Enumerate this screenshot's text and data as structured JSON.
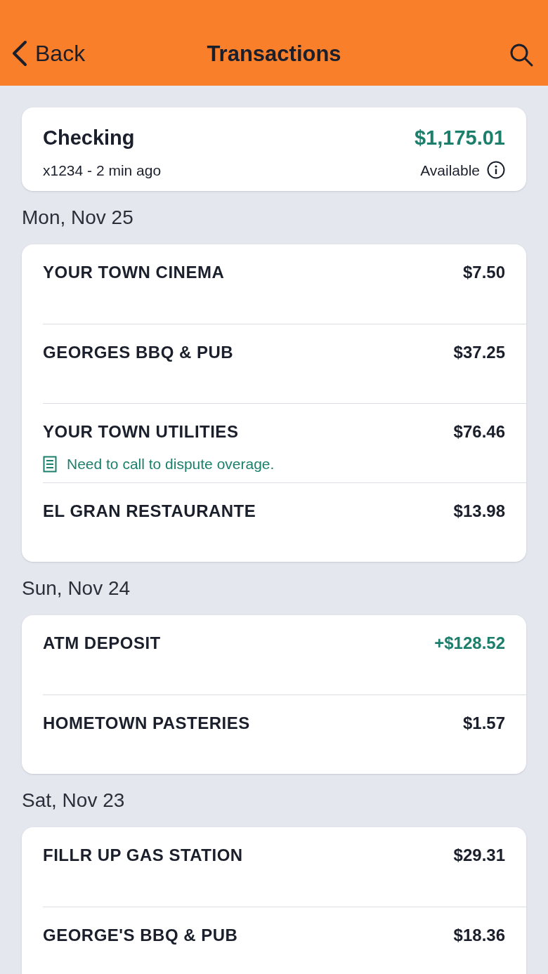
{
  "header": {
    "back": "Back",
    "title": "Transactions"
  },
  "account": {
    "name": "Checking",
    "meta": "x1234 - 2 min ago",
    "balance": "$1,175.01",
    "balance_label": "Available"
  },
  "groups": [
    {
      "date": "Mon, Nov 25",
      "transactions": [
        {
          "name": "YOUR TOWN CINEMA",
          "amount": "$7.50",
          "kind": "debit"
        },
        {
          "name": "GEORGES BBQ & PUB",
          "amount": "$37.25",
          "kind": "debit"
        },
        {
          "name": "YOUR TOWN UTILITIES",
          "amount": "$76.46",
          "kind": "debit",
          "note": "Need to call to dispute overage."
        },
        {
          "name": "EL GRAN RESTAURANTE",
          "amount": "$13.98",
          "kind": "debit"
        }
      ]
    },
    {
      "date": "Sun, Nov 24",
      "transactions": [
        {
          "name": "ATM DEPOSIT",
          "amount": "+$128.52",
          "kind": "credit"
        },
        {
          "name": "HOMETOWN PASTERIES",
          "amount": "$1.57",
          "kind": "debit"
        }
      ]
    },
    {
      "date": "Sat, Nov 23",
      "transactions": [
        {
          "name": "FILLR UP GAS STATION",
          "amount": "$29.31",
          "kind": "debit"
        },
        {
          "name": "GEORGE'S BBQ & PUB",
          "amount": "$18.36",
          "kind": "debit"
        }
      ]
    }
  ]
}
